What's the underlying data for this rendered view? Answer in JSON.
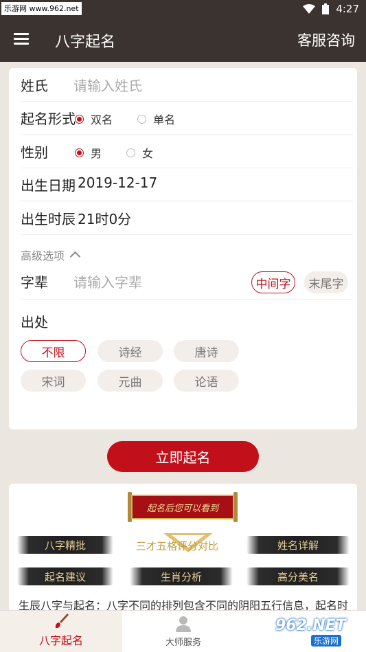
{
  "status_bar": {
    "watermark": "乐游网 www.962.net",
    "time": "4:27"
  },
  "app_bar": {
    "title": "八字起名",
    "service": "客服咨询"
  },
  "form": {
    "surname": {
      "label": "姓氏",
      "placeholder": "请输入姓氏"
    },
    "name_form": {
      "label": "起名形式",
      "options": [
        "双名",
        "单名"
      ],
      "selected": "双名"
    },
    "gender": {
      "label": "性别",
      "options": [
        "男",
        "女"
      ],
      "selected": "男"
    },
    "birth_date": {
      "label": "出生日期",
      "value": "2019-12-17"
    },
    "birth_time": {
      "label": "出生时辰",
      "value": "21时0分"
    },
    "advanced": {
      "label": "高级选项"
    },
    "generation": {
      "label": "字辈",
      "placeholder": "请输入字辈",
      "positions": [
        "中间字",
        "末尾字"
      ],
      "selected": "中间字"
    },
    "source": {
      "label": "出处",
      "options": [
        "不限",
        "诗经",
        "唐诗",
        "宋词",
        "元曲",
        "论语"
      ],
      "selected": "不限"
    }
  },
  "cta": {
    "label": "立即起名"
  },
  "promo": {
    "banner": "起名后您可以看到",
    "features": [
      "八字精批",
      "三才五格评分对比",
      "姓名详解",
      "起名建议",
      "生肖分析",
      "高分美名"
    ],
    "text": "生辰八字与起名：八字不同的排列包含不同的阴阳五行信息，起名时"
  },
  "tabs": [
    {
      "label": "八字起名",
      "icon": "brush-icon"
    },
    {
      "label": "大师服务",
      "icon": "person-icon"
    }
  ],
  "watermark_bottom": {
    "brand": "962.NET",
    "sub": "乐游网"
  },
  "colors": {
    "primary": "#c2101b",
    "header": "#3a3330",
    "background": "#ece6e1"
  }
}
